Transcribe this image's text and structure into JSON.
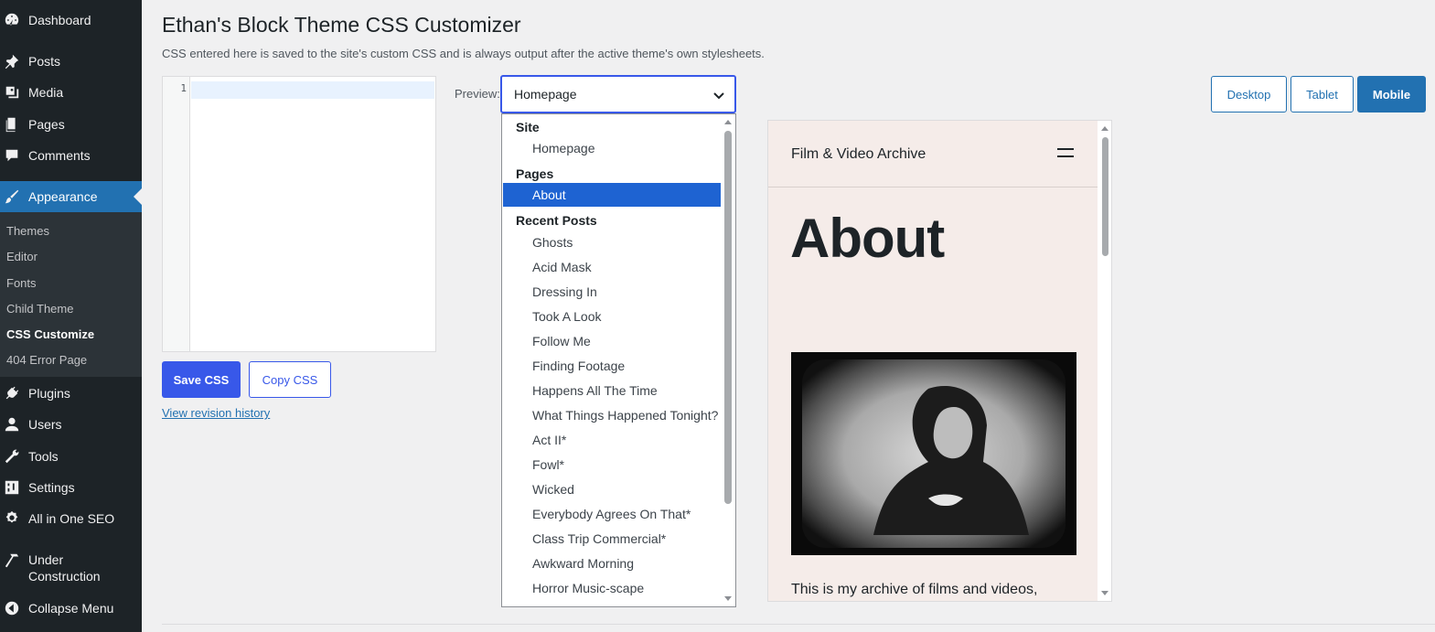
{
  "sidebar": {
    "menu": [
      {
        "label": "Dashboard",
        "icon": "dashboard-icon"
      },
      {
        "label": "Posts",
        "icon": "pin-icon"
      },
      {
        "label": "Media",
        "icon": "media-icon"
      },
      {
        "label": "Pages",
        "icon": "pages-icon"
      },
      {
        "label": "Comments",
        "icon": "comment-icon"
      },
      {
        "label": "Appearance",
        "icon": "brush-icon"
      },
      {
        "label": "Plugins",
        "icon": "plug-icon"
      },
      {
        "label": "Users",
        "icon": "user-icon"
      },
      {
        "label": "Tools",
        "icon": "wrench-icon"
      },
      {
        "label": "Settings",
        "icon": "settings-sliders-icon"
      },
      {
        "label": "All in One SEO",
        "icon": "seo-icon"
      },
      {
        "label": "Under Construction",
        "icon": "hammer-icon"
      },
      {
        "label": "Collapse Menu",
        "icon": "collapse-icon"
      }
    ],
    "submenu": [
      "Themes",
      "Editor",
      "Fonts",
      "Child Theme",
      "CSS Customize",
      "404 Error Page"
    ],
    "submenu_current": "CSS Customize"
  },
  "main": {
    "title": "Ethan's Block Theme CSS Customizer",
    "description": "CSS entered here is saved to the site's custom CSS and is always output after the active theme's own stylesheets.",
    "editor": {
      "line_number": "1",
      "content": ""
    },
    "save_label": "Save CSS",
    "copy_label": "Copy CSS",
    "revision_link": "View revision history"
  },
  "preview": {
    "label": "Preview:",
    "selected_value": "Homepage",
    "groups": [
      {
        "name": "Site",
        "options": [
          "Homepage"
        ]
      },
      {
        "name": "Pages",
        "options": [
          "About"
        ]
      },
      {
        "name": "Recent Posts",
        "options": [
          "Ghosts",
          "Acid Mask",
          "Dressing In",
          "Took A Look",
          "Follow Me",
          "Finding Footage",
          "Happens All The Time",
          "What Things Happened Tonight?",
          "Act II*",
          "Fowl*",
          "Wicked",
          "Everybody Agrees On That*",
          "Class Trip Commercial*",
          "Awkward Morning",
          "Horror Music-scape"
        ]
      }
    ],
    "highlighted_option": "About",
    "devices": [
      "Desktop",
      "Tablet",
      "Mobile"
    ],
    "active_device": "Mobile",
    "frame": {
      "site_title": "Film & Video Archive",
      "heading": "About",
      "body_text": "This is my archive of films and videos,"
    }
  },
  "colors": {
    "sidebar_bg": "#1d2327",
    "accent": "#2271b1",
    "primary_button": "#3858e9",
    "dropdown_highlight": "#1e63d2",
    "preview_bg": "#f5ece9"
  }
}
